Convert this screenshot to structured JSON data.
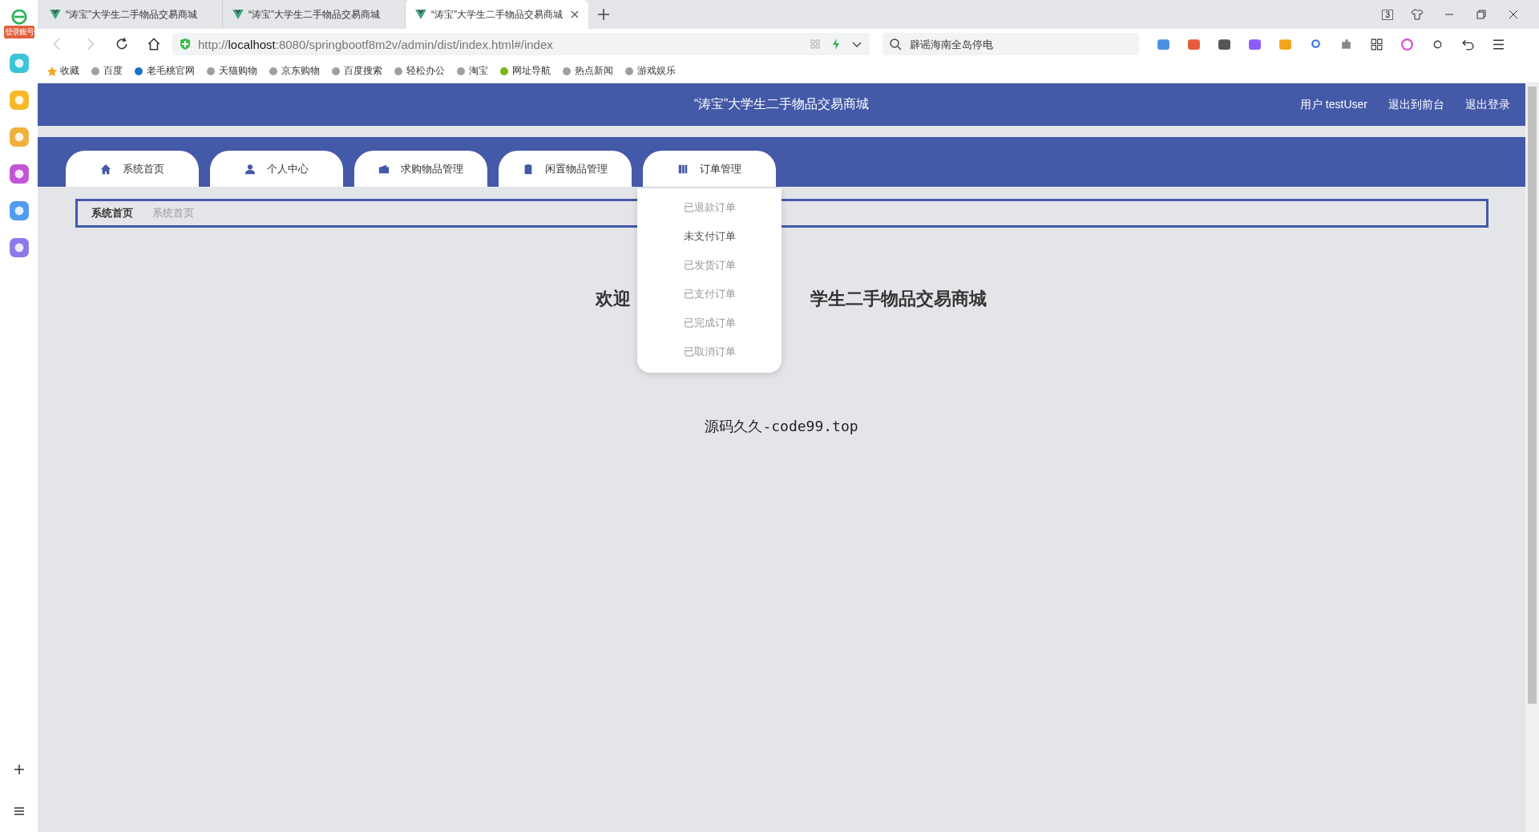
{
  "sidebar": {
    "login_badge": "登录账号"
  },
  "browser": {
    "tabs": [
      {
        "title": "“涛宝”大学生二手物品交易商城",
        "selected": false
      },
      {
        "title": "“涛宝”大学生二手物品交易商城",
        "selected": false
      },
      {
        "title": "“涛宝”大学生二手物品交易商城",
        "selected": true
      }
    ],
    "tab_count": "3",
    "url": {
      "scheme": "http://",
      "host": "localhost",
      "path": ":8080/springbootf8m2v/admin/dist/index.html#/index"
    },
    "search_placeholder": "辟谣海南全岛停电",
    "bookmarks": [
      "收藏",
      "百度",
      "老毛桃官网",
      "天猫购物",
      "京东购物",
      "百度搜索",
      "轻松办公",
      "淘宝",
      "网址导航",
      "热点新闻",
      "游戏娱乐"
    ]
  },
  "header": {
    "title": "“涛宝”大学生二手物品交易商城",
    "links": [
      "用户 testUser",
      "退出到前台",
      "退出登录"
    ]
  },
  "nav": [
    "系统首页",
    "个人中心",
    "求购物品管理",
    "闲置物品管理",
    "订单管理"
  ],
  "dropdown": {
    "items": [
      {
        "label": "已退款订单",
        "selected": false
      },
      {
        "label": "未支付订单",
        "selected": true
      },
      {
        "label": "已发货订单",
        "selected": false
      },
      {
        "label": "已支付订单",
        "selected": false
      },
      {
        "label": "已完成订单",
        "selected": false
      },
      {
        "label": "已取消订单",
        "selected": false
      }
    ]
  },
  "breadcrumb": [
    "系统首页",
    "系统首页"
  ],
  "welcome": {
    "parts": [
      "欢迎",
      "学生二手物品交易商城"
    ]
  },
  "footer_note": "源码久久-code99.top"
}
